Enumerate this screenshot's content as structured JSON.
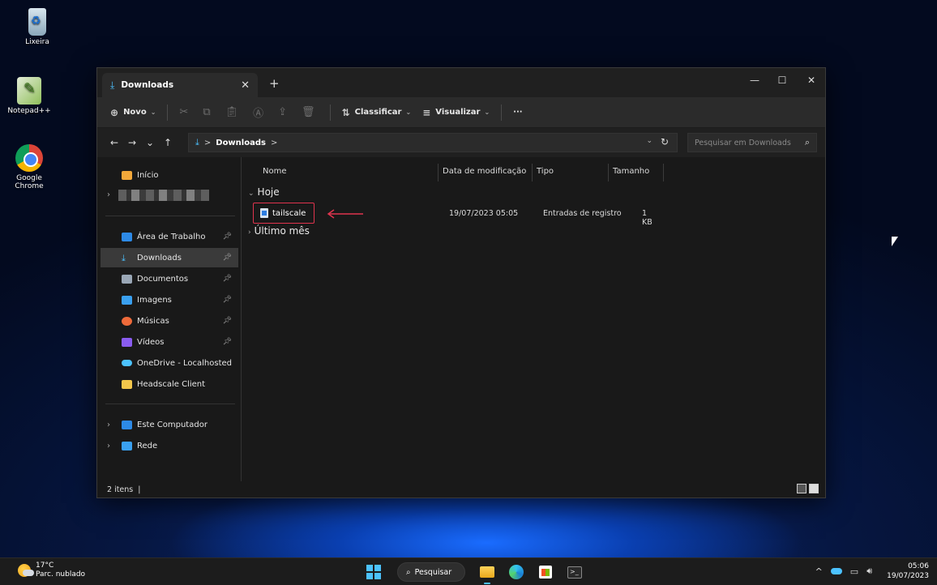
{
  "desktop": {
    "icons": [
      {
        "label": "Lixeira"
      },
      {
        "label": "Notepad++"
      },
      {
        "label": "Google\nChrome"
      }
    ]
  },
  "explorer": {
    "tab": {
      "label": "Downloads",
      "close": "✕",
      "new_tab": "+"
    },
    "window_controls": {
      "minimize": "—",
      "maximize": "☐",
      "close": "✕"
    },
    "toolbar": {
      "new_label": "Novo",
      "sort_label": "Classificar",
      "view_label": "Visualizar",
      "more": "···"
    },
    "nav": {
      "back": "←",
      "forward": "→",
      "recent": "⌄",
      "up": "↑"
    },
    "address": {
      "sep": ">",
      "text": "Downloads",
      "trail": ">"
    },
    "search": {
      "placeholder": "Pesquisar em Downloads"
    },
    "nav_pane": {
      "home": "Início",
      "quick": [
        {
          "label": "Área de Trabalho",
          "color": "#2d8ae6",
          "pinned": true
        },
        {
          "label": "Downloads",
          "color": "#4cc2ff",
          "pinned": true,
          "active": true
        },
        {
          "label": "Documentos",
          "color": "#9aa7b6",
          "pinned": true
        },
        {
          "label": "Imagens",
          "color": "#3aa0f0",
          "pinned": true
        },
        {
          "label": "Músicas",
          "color": "#ee6a3a",
          "pinned": true
        },
        {
          "label": "Vídeos",
          "color": "#8a5cf0",
          "pinned": true
        },
        {
          "label": "OneDrive - Localhosted",
          "color": "#4cc2ff",
          "pinned": false
        },
        {
          "label": "Headscale Client",
          "color": "#f2c64b",
          "pinned": false
        }
      ],
      "computer": "Este Computador",
      "network": "Rede"
    },
    "columns": {
      "name": "Nome",
      "modified": "Data de modificação",
      "type": "Tipo",
      "size": "Tamanho"
    },
    "groups": {
      "today": "Hoje",
      "last_month": "Último mês"
    },
    "file": {
      "name": "tailscale",
      "modified": "19/07/2023 05:05",
      "type": "Entradas de registro",
      "size": "1 KB"
    },
    "status": "2 itens  |"
  },
  "taskbar": {
    "weather": {
      "temp": "17°C",
      "desc": "Parc. nublado"
    },
    "search_label": "Pesquisar",
    "clock": {
      "time": "05:06",
      "date": "19/07/2023"
    }
  },
  "colors": {
    "accent": "#4cc2ff",
    "highlight_box": "#e0344e"
  }
}
